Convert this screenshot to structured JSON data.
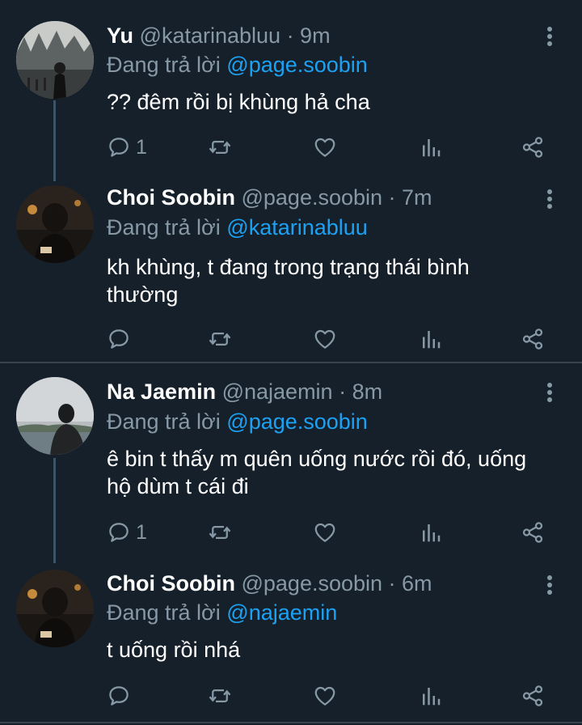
{
  "replying_prefix": "Đang trả lời",
  "tweets": [
    {
      "name": "Yu",
      "handle": "@katarinabluu",
      "time": "· 9m",
      "reply_to": "@page.soobin",
      "text": "?? đêm rồi bị khùng hả cha",
      "reply_count": "1"
    },
    {
      "name": "Choi Soobin",
      "handle": "@page.soobin",
      "time": "· 7m",
      "reply_to": "@katarinabluu",
      "text": "kh khùng, t đang trong trạng thái bình thường",
      "reply_count": ""
    },
    {
      "name": "Na Jaemin",
      "handle": "@najaemin",
      "time": "· 8m",
      "reply_to": "@page.soobin",
      "text": "ê bin t thấy m quên uống nước rồi đó, uống hộ dùm t cái đi",
      "reply_count": "1"
    },
    {
      "name": "Choi Soobin",
      "handle": "@page.soobin",
      "time": "· 6m",
      "reply_to": "@najaemin",
      "text": "t uống rồi nhá",
      "reply_count": ""
    }
  ],
  "colors": {
    "background": "#15202b",
    "accent": "#1da1f2",
    "muted": "#8899a6",
    "line": "#3d5466"
  },
  "icons": [
    "reply-icon",
    "retweet-icon",
    "like-icon",
    "analytics-icon",
    "share-icon",
    "more-icon"
  ]
}
